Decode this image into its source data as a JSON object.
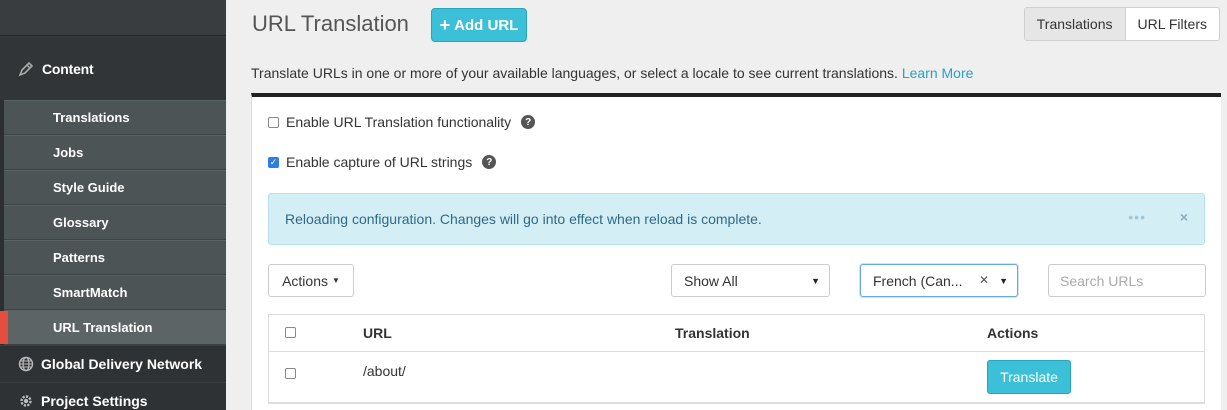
{
  "sidebar": {
    "content_label": "Content",
    "items": [
      {
        "label": "Translations"
      },
      {
        "label": "Jobs"
      },
      {
        "label": "Style Guide"
      },
      {
        "label": "Glossary"
      },
      {
        "label": "Patterns"
      },
      {
        "label": "SmartMatch"
      },
      {
        "label": "URL Translation"
      }
    ],
    "gdn_label": "Global Delivery Network",
    "settings_label": "Project Settings",
    "active_accent": "#e54d3e"
  },
  "header": {
    "title": "URL Translation",
    "add_url_label": "Add URL",
    "tabs": [
      {
        "label": "Translations"
      },
      {
        "label": "URL Filters"
      }
    ]
  },
  "description": {
    "text": "Translate URLs in one or more of your available languages, or select a locale to see current translations.",
    "link_text": "Learn More"
  },
  "settings": {
    "enable_url_translation": {
      "label": "Enable URL Translation functionality",
      "checked": false
    },
    "enable_capture": {
      "label": "Enable capture of URL strings",
      "checked": true
    }
  },
  "alert": {
    "text": "Reloading configuration. Changes will go into effect when reload is complete."
  },
  "toolbar": {
    "actions_label": "Actions",
    "filter_value": "Show All",
    "language_value": "French (Can...",
    "search_placeholder": "Search URLs"
  },
  "table": {
    "headers": {
      "url": "URL",
      "translation": "Translation",
      "actions": "Actions"
    },
    "rows": [
      {
        "url": "/about/",
        "translation": "",
        "action_label": "Translate"
      }
    ]
  },
  "colors": {
    "primary": "#3cc0d8",
    "link": "#2a9fc9",
    "alert_bg": "#d4eef6"
  }
}
